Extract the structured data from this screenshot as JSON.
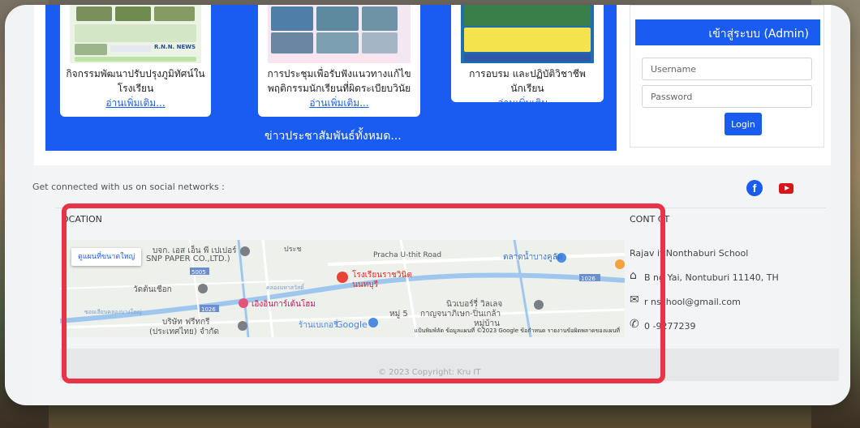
{
  "news": {
    "cards": [
      {
        "title_line1": "กิจกรรมพัฒนาปรับปรุงภูมิทัศน์ใน",
        "title_line2": "โรงเรียน",
        "more": "อ่านเพิ่มเติม...",
        "thumb_caption": "R.N.N. NEWS"
      },
      {
        "title_line1": "การประชุมเพื่อรับฟังแนวทางแก้ไข",
        "title_line2": "พฤติกรรมนักเรียนที่ผิดระเบียบวินัย",
        "more": "อ่านเพิ่มเติม..."
      },
      {
        "title_line1": "การอบรม และปฏิบัติวิชาชีพนักเรียน",
        "title_line2": "",
        "more": "อ่านเพิ่มเติม..."
      }
    ],
    "all_link": "ข่าวประชาสัมพันธ์ทั้งหมด..."
  },
  "login": {
    "title": "เข้าสู่ระบบ (Admin)",
    "username_placeholder": "Username",
    "password_placeholder": "Password",
    "button": "Login"
  },
  "social": {
    "text": "Get connected with us on social networks :",
    "icons": [
      "facebook-icon",
      "youtube-icon"
    ]
  },
  "location": {
    "title": "OCATION",
    "map": {
      "button": "ดูแผนที่ขนาดใหญ่",
      "labels": {
        "snp": "บจก. เอส เอ็น พี เปเปอร์",
        "snp2": "SNP PAPER CO.,LTD.)",
        "road": "Pracha U-thit Road",
        "market": "ตลาดน้ำบางคูลัด",
        "school1": "โรงเรียนราชวินิต",
        "school2": "นนทบุรี",
        "temple": "วัดต้นเชือก",
        "shop": "เอิงอินการ์เด้นโฮม",
        "village": "นิวเบอร์รี่ วิลเลจ",
        "kanchana": "กาญจนาภิเษก-ปิ่นเกล้า",
        "moo5": "หมู่ 5",
        "moo_ban": "หมู่บ้าน",
        "company1": "บริษัท ฟรีทกรี",
        "company2": "(ประเทศไทย) จำกัด",
        "store": "ร้านเบเกอรี่",
        "google": "Google",
        "r5005": "5005",
        "r1026a": "1026",
        "r1026b": "1026",
        "thai1": "ประช",
        "thai2": "คลองมหาสวัสดิ์",
        "thai3": "ซอยเลียบคลองบางใหญ่"
      },
      "footer": "แป้นพิมพ์ลัด   ข้อมูลแผนที่ ©2023 Google   ข้อกำหนด   รายงานข้อผิดพลาดของแผนที่"
    }
  },
  "contact": {
    "title": "CONT  CT",
    "name": "Rajav   it Nonthaburi School",
    "address": "B  ng Yai, Nontuburi 11140, TH",
    "email": "r   nschool@gmail.com",
    "phone": "0   -9277239"
  },
  "footer": {
    "copyright": "© 2023 Copyright: Kru IT"
  },
  "colors": {
    "brand_blue": "#1a5cf0",
    "highlight_red": "#e83446"
  }
}
